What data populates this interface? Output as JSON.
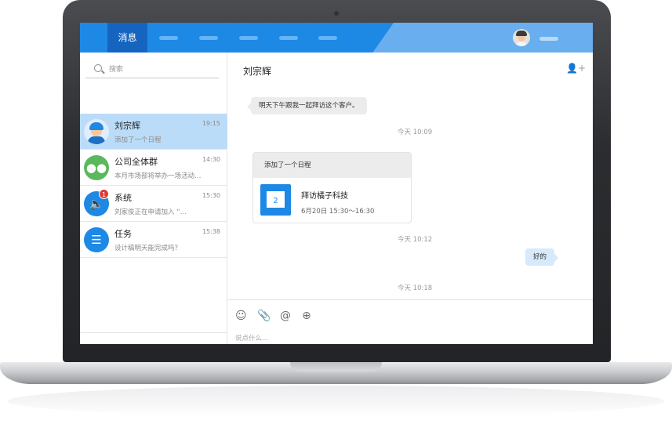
{
  "nav": {
    "active_tab": "消息"
  },
  "search": {
    "placeholder": "搜索"
  },
  "conversations": [
    {
      "name": "刘宗辉",
      "preview": "添加了一个日程",
      "time": "19:15",
      "avatar": "user-avatar"
    },
    {
      "name": "公司全体群",
      "preview": "本月市场部将举办一场活动…",
      "time": "14:30",
      "avatar": "group-icon"
    },
    {
      "name": "系统",
      "preview": "刘家俊正在申请加入 “…",
      "time": "15:30",
      "avatar": "speaker-icon",
      "badge": "1"
    },
    {
      "name": "任务",
      "preview": "设计稿明天能完成吗？",
      "time": "15:38",
      "avatar": "task-icon"
    }
  ],
  "chat": {
    "title": "刘宗辉",
    "messages": {
      "m1": "明天下午跟我一起拜访这个客户。",
      "ts1": "今天 10:09",
      "card_header": "添加了一个日程",
      "card_day": "2",
      "card_title": "拜访橘子科技",
      "card_time": "6月20日 15:30～16:30",
      "ts2": "今天 10:12",
      "m2": "好的",
      "ts3": "今天 10:18"
    },
    "input_placeholder": "说点什么..."
  },
  "colors": {
    "brand": "#1e88e5",
    "active_row": "#bbdcf8",
    "badge": "#e53935"
  }
}
